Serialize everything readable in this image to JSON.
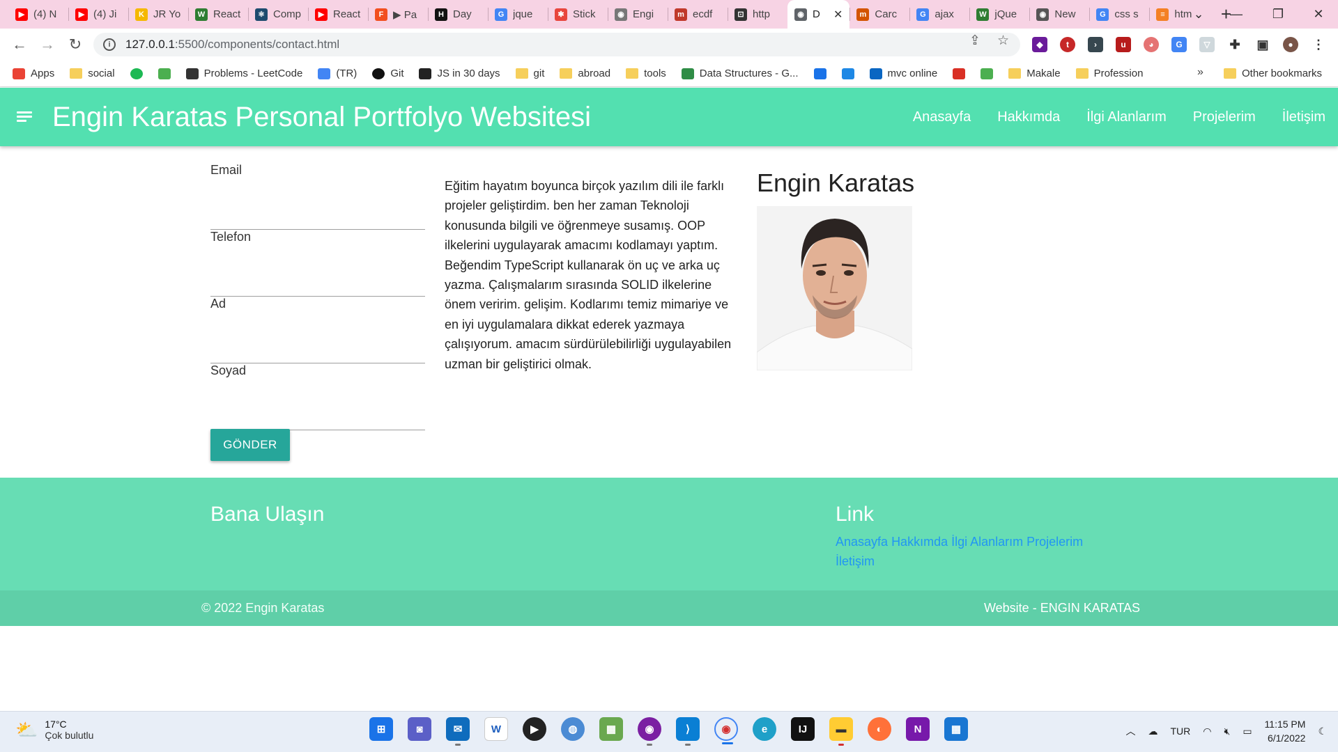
{
  "browser": {
    "tabs": [
      {
        "title": "(4) N",
        "color": "#ff0000",
        "glyph": "▶"
      },
      {
        "title": "(4) Ji",
        "color": "#ff0000",
        "glyph": "▶"
      },
      {
        "title": "JR Yo",
        "color": "#f5b800",
        "glyph": "K"
      },
      {
        "title": "React",
        "color": "#2e7d32",
        "glyph": "W"
      },
      {
        "title": "Comp",
        "color": "#1d4b6e",
        "glyph": "⚛"
      },
      {
        "title": "React",
        "color": "#ff0000",
        "glyph": "▶"
      },
      {
        "title": "▶ Pa",
        "color": "#f24e1e",
        "glyph": "F"
      },
      {
        "title": "Day",
        "color": "#111111",
        "glyph": "H"
      },
      {
        "title": "jque",
        "color": "#4285f4",
        "glyph": "G"
      },
      {
        "title": "Stick",
        "color": "#e8453c",
        "glyph": "✱"
      },
      {
        "title": "Engi",
        "color": "#777777",
        "glyph": "◉"
      },
      {
        "title": "ecdf",
        "color": "#c0392b",
        "glyph": "m"
      },
      {
        "title": "http",
        "color": "#333333",
        "glyph": "⊡"
      },
      {
        "title": "D",
        "color": "#5f6368",
        "glyph": "◉",
        "active": true
      },
      {
        "title": "Carc",
        "color": "#d35400",
        "glyph": "m"
      },
      {
        "title": "ajax",
        "color": "#4285f4",
        "glyph": "G"
      },
      {
        "title": "jQue",
        "color": "#2e7d32",
        "glyph": "W"
      },
      {
        "title": "New",
        "color": "#555555",
        "glyph": "◉"
      },
      {
        "title": "css s",
        "color": "#4285f4",
        "glyph": "G"
      },
      {
        "title": "htm",
        "color": "#f48024",
        "glyph": "≡"
      }
    ],
    "new_tab": "+",
    "url_host": "127.0.0.1",
    "url_path": ":5500/components/contact.html",
    "bookmarks": [
      {
        "label": "Apps",
        "type": "apps"
      },
      {
        "label": "social",
        "type": "folder"
      },
      {
        "label": "",
        "type": "spotify"
      },
      {
        "label": "",
        "type": "leaf"
      },
      {
        "label": "Problems - LeetCode",
        "type": "leetcode"
      },
      {
        "label": "(TR)",
        "type": "translate"
      },
      {
        "label": "Git",
        "type": "github"
      },
      {
        "label": "JS in 30 days",
        "type": "js30"
      },
      {
        "label": "git",
        "type": "folder"
      },
      {
        "label": "abroad",
        "type": "folder"
      },
      {
        "label": "tools",
        "type": "folder"
      },
      {
        "label": "Data Structures - G...",
        "type": "gfg"
      },
      {
        "label": "",
        "type": "crossx"
      },
      {
        "label": "",
        "type": "html5"
      },
      {
        "label": "mvc online",
        "type": "mvc"
      },
      {
        "label": "",
        "type": "gmail"
      },
      {
        "label": "",
        "type": "bar"
      },
      {
        "label": "Makale",
        "type": "folder"
      },
      {
        "label": "Profession",
        "type": "folder"
      }
    ],
    "more_bookmarks": "»",
    "other_bookmarks": "Other bookmarks"
  },
  "site": {
    "brand": "Engin Karatas Personal Portfolyo Websitesi",
    "nav": [
      "Anasayfa",
      "Hakkımda",
      "İlgi Alanlarım",
      "Projelerim",
      "İletişim"
    ],
    "form": {
      "fields": [
        "Email",
        "Telefon",
        "Ad",
        "Soyad"
      ],
      "submit": "GÖNDER"
    },
    "about": "Eğitim hayatım boyunca birçok yazılım dili ile farklı projeler geliştirdim. ben her zaman Teknoloji konusunda bilgili ve öğrenmeye susamış. OOP ilkelerini uygulayarak amacımı kodlamayı yaptım. Beğendim TypeScript kullanarak ön uç ve arka uç yazma. Çalışmalarım sırasında SOLID ilkelerine önem veririm. gelişim. Kodlarımı temiz mimariye ve en iyi uygulamalara dikkat ederek yazmaya çalışıyorum. amacım sürdürülebilirliği uygulayabilen uzman bir geliştirici olmak.",
    "profile_name": "Engin Karatas",
    "footer": {
      "left_title": "Bana Ulaşın",
      "right_title": "Link",
      "links": [
        "Anasayfa",
        "Hakkımda",
        "İlgi Alanlarım",
        "Projelerim",
        "İletişim"
      ],
      "copyright": "© 2022 Engin Karatas",
      "credit": "Website - ENGIN KARATAS"
    },
    "colors": {
      "primary": "#53e0b0",
      "footer": "#67ddb4",
      "button": "#26a69a",
      "link": "#2196f3"
    }
  },
  "taskbar": {
    "temperature": "17°C",
    "weather": "Çok bulutlu",
    "language": "TUR",
    "time": "11:15 PM",
    "date": "6/1/2022"
  }
}
